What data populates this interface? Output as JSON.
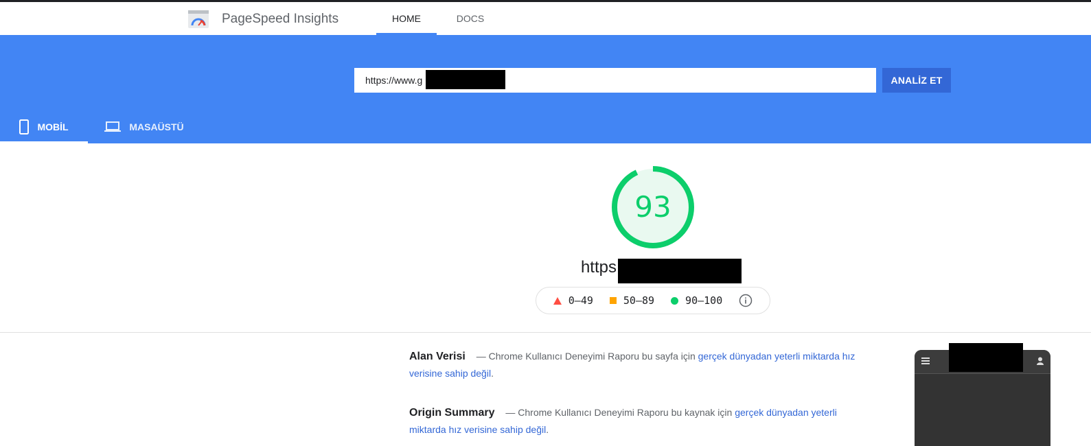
{
  "header": {
    "brand": "PageSpeed Insights",
    "nav": [
      {
        "label": "HOME",
        "active": true
      },
      {
        "label": "DOCS",
        "active": false
      }
    ]
  },
  "search": {
    "url_value": "https://www.g           .com/",
    "analyze_label": "ANALİZ ET"
  },
  "device_tabs": [
    {
      "label": "MOBİL",
      "icon": "phone-icon",
      "active": true
    },
    {
      "label": "MASAÜSTÜ",
      "icon": "laptop-icon",
      "active": false
    }
  ],
  "result": {
    "score": "93",
    "score_fraction": 0.93,
    "score_color": "#0cce6b",
    "tested_url": "https://www.ga                       r.com/"
  },
  "legend": [
    {
      "label": "0–49",
      "color": "#ff4e42",
      "shape": "triangle"
    },
    {
      "label": "50–89",
      "color": "#ffa400",
      "shape": "square"
    },
    {
      "label": "90–100",
      "color": "#0cce6b",
      "shape": "circle"
    }
  ],
  "field_data": {
    "title": "Alan Verisi",
    "text": "— Chrome Kullanıcı Deneyimi Raporu bu sayfa için",
    "link": "gerçek dünyadan yeterli miktarda hız verisine sahip değil",
    "end": "."
  },
  "origin_summary": {
    "title": "Origin Summary",
    "text": "— Chrome Kullanıcı Deneyimi Raporu bu kaynak için",
    "link": "gerçek dünyadan yeterli miktarda hız verisine sahip değil",
    "end": "."
  },
  "colors": {
    "brand_blue": "#4285f4",
    "button_blue": "#3367d6",
    "good_green": "#0cce6b"
  }
}
